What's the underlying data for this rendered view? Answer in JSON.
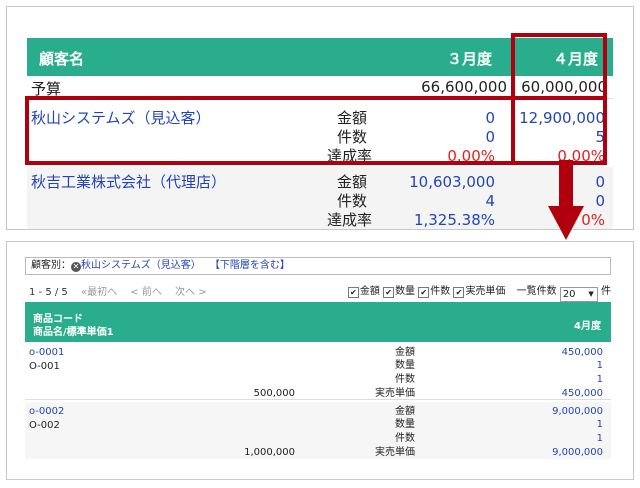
{
  "top": {
    "header": {
      "customer": "顧客名",
      "march": "３月度",
      "april": "４月度"
    },
    "budget": {
      "label": "予算",
      "march": "66,600,000",
      "april": "60,000,000"
    },
    "customers": [
      {
        "name": "秋山システムズ（見込客）",
        "labels": [
          "金額",
          "件数",
          "達成率"
        ],
        "march": [
          "0",
          "0",
          "0.00%"
        ],
        "april": [
          "12,900,000",
          "5",
          "0.00%"
        ]
      },
      {
        "name": "秋吉工業株式会社（代理店）",
        "labels": [
          "金額",
          "件数",
          "達成率"
        ],
        "march": [
          "10,603,000",
          "4",
          "1,325.38%"
        ],
        "april": [
          "0",
          "0",
          "0%"
        ]
      }
    ]
  },
  "bottom": {
    "filter": {
      "prefix": "顧客別：",
      "customer": "秋山システムズ（見込客）",
      "include": "【下階層を含む】"
    },
    "pager": {
      "range": "1 - 5 / 5",
      "first": "«最初へ",
      "prev": "< 前へ",
      "next": "次へ >"
    },
    "options": {
      "amount": "金額",
      "quantity": "数量",
      "count": "件数",
      "unit_price": "実売単価",
      "per_page_label": "一覧件数",
      "per_page": "20",
      "unit": "件"
    },
    "header": {
      "line1": "商品コード",
      "line2": "商品名/標準単価1",
      "april": "4月度"
    },
    "products": [
      {
        "code": "o-0001",
        "name": "O-001",
        "std_price": "500,000",
        "labels": [
          "金額",
          "数量",
          "件数",
          "実売単価"
        ],
        "values": [
          "450,000",
          "1",
          "1",
          "450,000"
        ]
      },
      {
        "code": "o-0002",
        "name": "O-002",
        "std_price": "1,000,000",
        "labels": [
          "金額",
          "数量",
          "件数",
          "実売単価"
        ],
        "values": [
          "9,000,000",
          "1",
          "1",
          "9,000,000"
        ]
      }
    ]
  }
}
